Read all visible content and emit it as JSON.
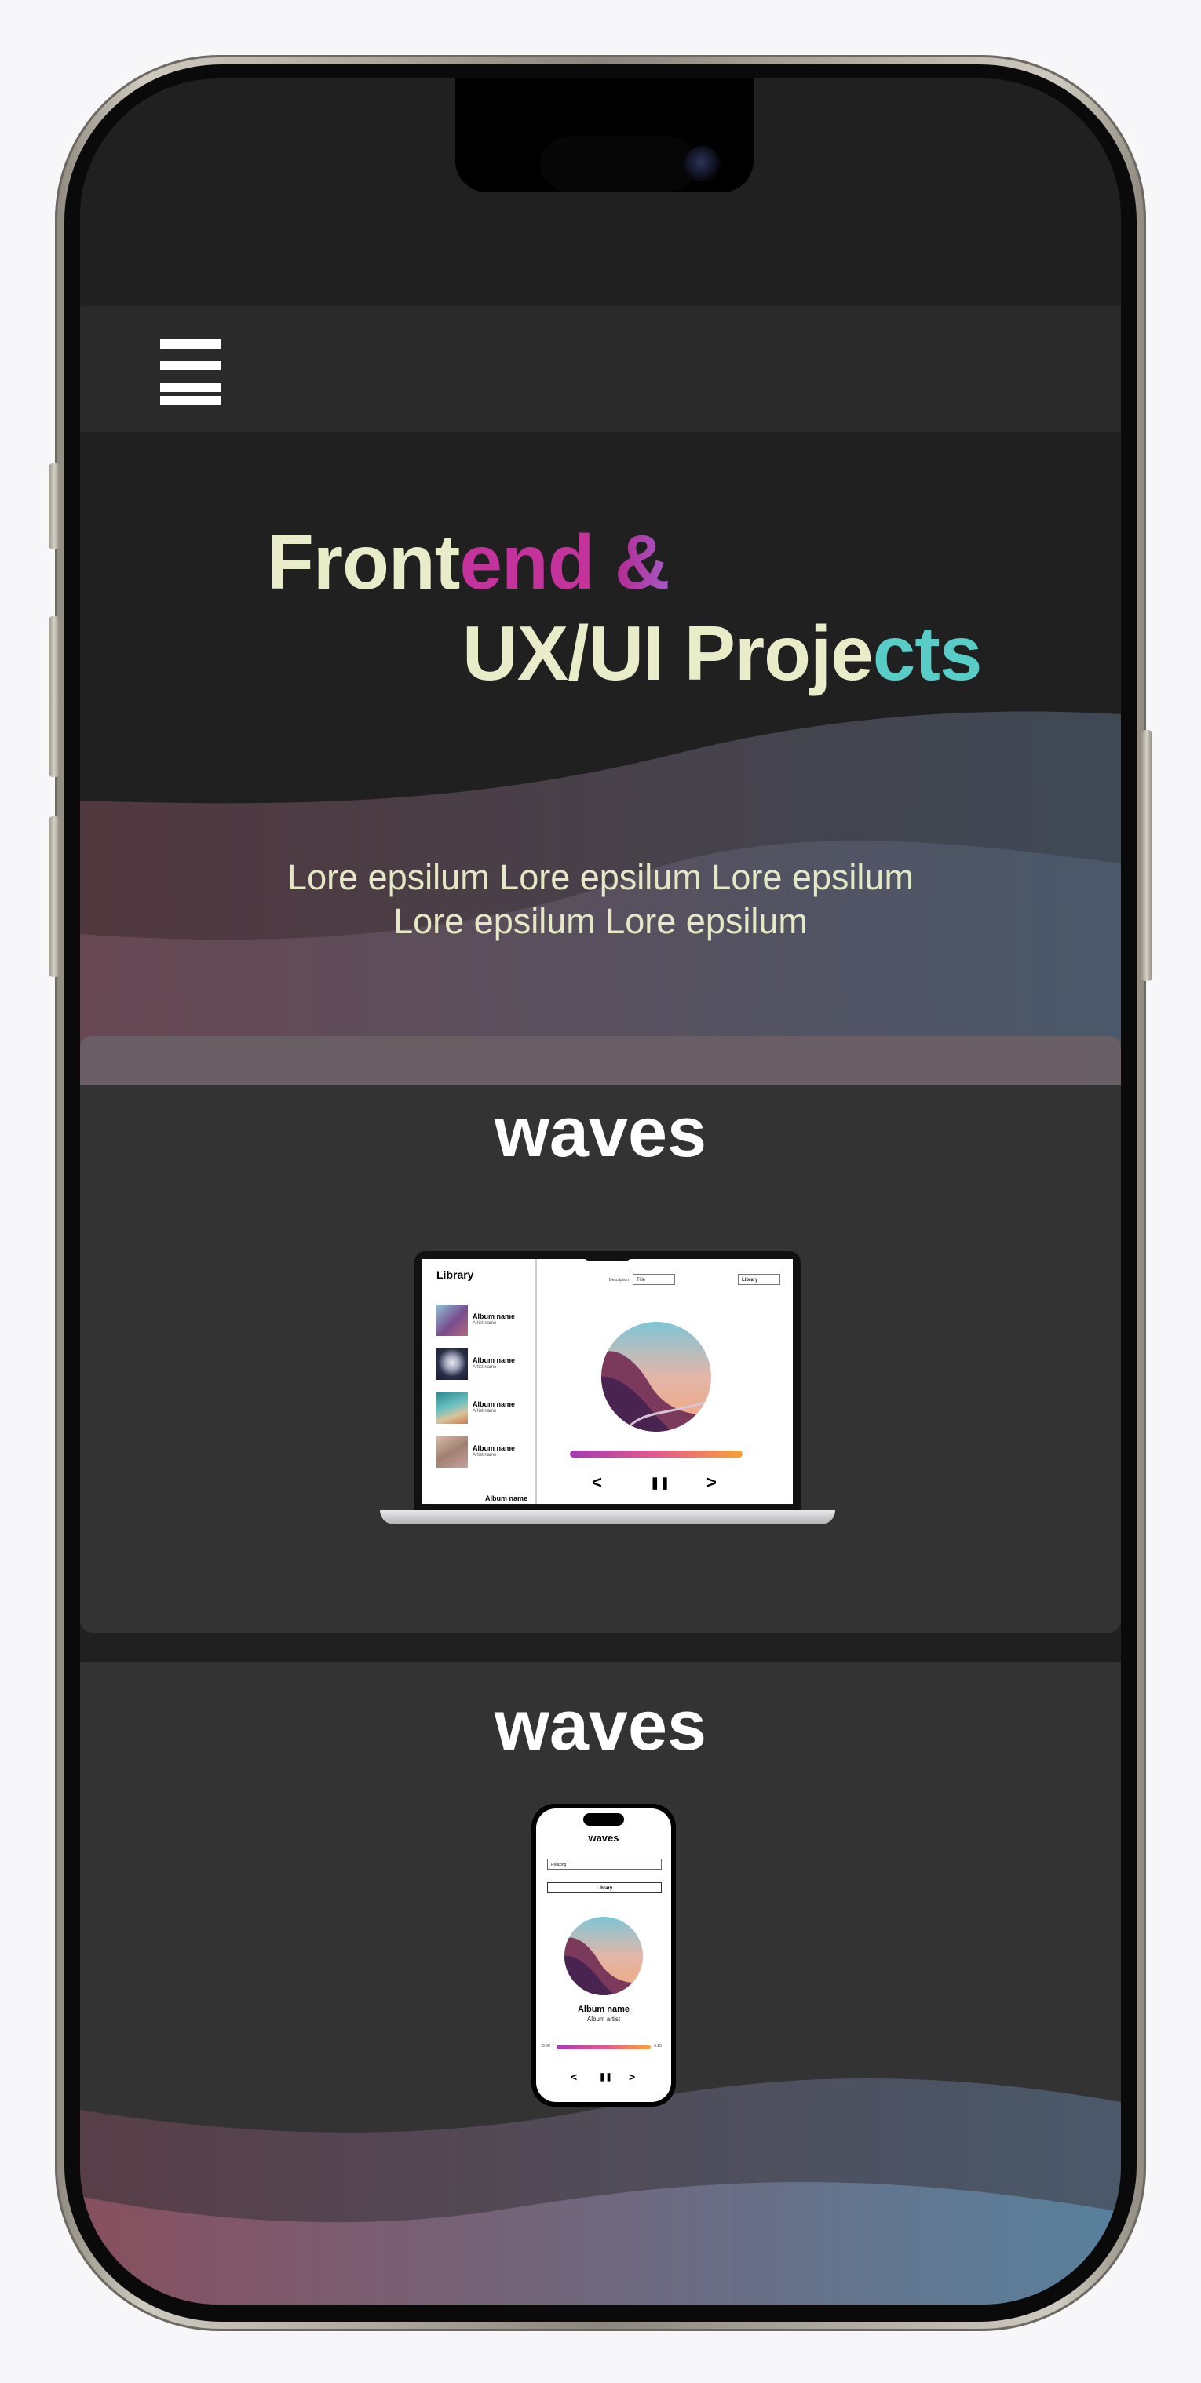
{
  "nav": {
    "menu_icon": "hamburger-menu-icon"
  },
  "hero": {
    "title_line1_a": "Front",
    "title_line1_b": "end",
    "title_line1_c": " ",
    "title_line1_amp": "&",
    "title_line2_a": "UX/UI Proje",
    "title_line2_b": "cts",
    "subtitle_line1": "Lore epsilum Lore epsilum  Lore epsilum",
    "subtitle_line2": "Lore epsilum  Lore epsilum"
  },
  "projects": [
    {
      "title": "waves",
      "mockup": {
        "library_title": "Library",
        "albums": [
          {
            "name": "Album name",
            "artist": "Artist name"
          },
          {
            "name": "Album name",
            "artist": "Artist name"
          },
          {
            "name": "Album name",
            "artist": "Artist name"
          },
          {
            "name": "Album name",
            "artist": "Artist name"
          },
          {
            "name": "Album name"
          }
        ],
        "description_label": "Description",
        "select_value": "Title",
        "library_button": "Library",
        "prev": "<",
        "pause": "❚❚",
        "next": ">"
      }
    },
    {
      "title": "waves",
      "mockup": {
        "app_title": "waves",
        "select_value": "Relaxing",
        "library_button": "Library",
        "album_name": "Album name",
        "album_artist": "Album artist",
        "time_start": "0:00",
        "time_end": "3:15",
        "prev": "<",
        "pause": "❚❚",
        "next": ">"
      }
    }
  ],
  "colors": {
    "background": "#202020",
    "navbar": "#2a2a2a",
    "card": "#333333",
    "title_cream": "#e8ecc8",
    "accent_pink": "#c4329c",
    "accent_teal": "#58cdc8"
  }
}
